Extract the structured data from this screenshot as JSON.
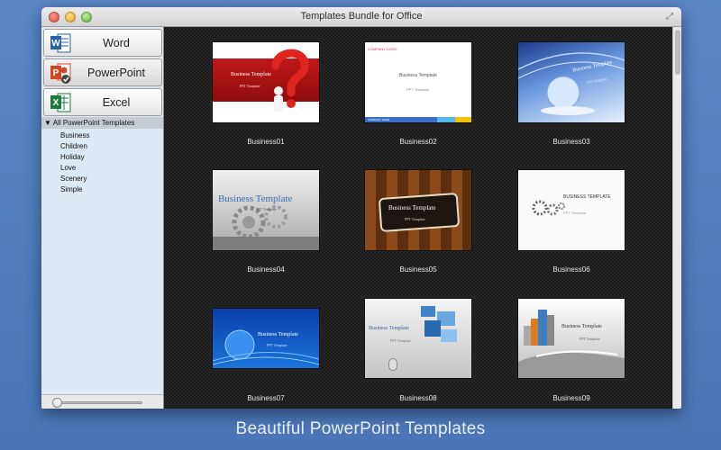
{
  "window": {
    "title": "Templates Bundle for Office"
  },
  "apps": [
    {
      "label": "Word",
      "icon": "word-icon",
      "color": "#2b5faa"
    },
    {
      "label": "PowerPoint",
      "icon": "powerpoint-icon",
      "color": "#d24726"
    },
    {
      "label": "Excel",
      "icon": "excel-icon",
      "color": "#1e7b3d"
    }
  ],
  "tree": {
    "header": "All PowerPoint Templates",
    "items": [
      "Business",
      "Children",
      "Holiday",
      "Love",
      "Scenery",
      "Simple"
    ]
  },
  "templates": [
    {
      "name": "Business01",
      "title": "Business Template",
      "sub": "PPT Template"
    },
    {
      "name": "Business02",
      "title": "Business Template",
      "sub": "PPT Template",
      "logo": "COMPANY LOGO",
      "footer": "COMPANY NAME"
    },
    {
      "name": "Business03",
      "title": "Business Template",
      "sub": "PPT Template"
    },
    {
      "name": "Business04",
      "title": "Business Template",
      "sub": "PPT Template"
    },
    {
      "name": "Business05",
      "title": "Business Template",
      "sub": "PPT Template"
    },
    {
      "name": "Business06",
      "title": "BUSINESS TEMPLATE",
      "sub": "PPT Template"
    },
    {
      "name": "Business07",
      "title": "Business Template",
      "sub": "PPT Template"
    },
    {
      "name": "Business08",
      "title": "Business Template",
      "sub": "PPT Template"
    },
    {
      "name": "Business09",
      "title": "Business Template",
      "sub": "PPT Template"
    }
  ],
  "caption": "Beautiful PowerPoint Templates"
}
